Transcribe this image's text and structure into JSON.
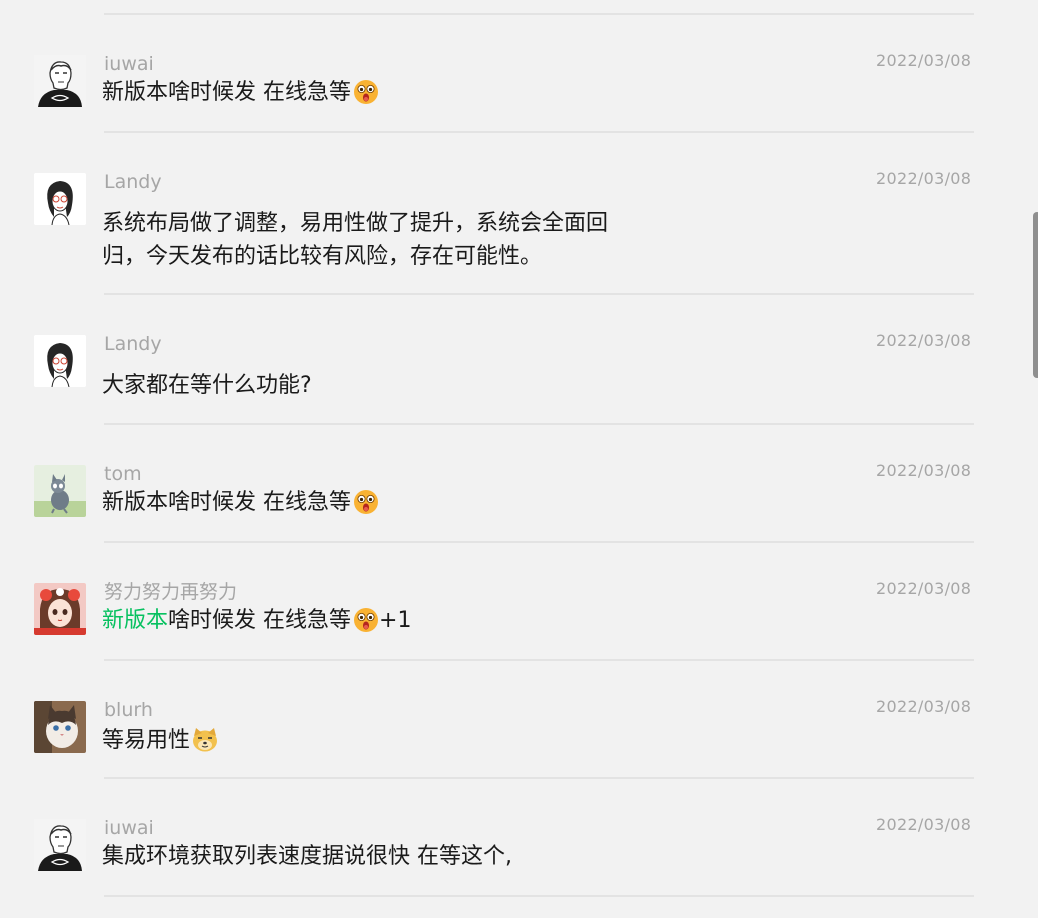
{
  "messages": [
    {
      "author": "iuwai",
      "date": "2022/03/08",
      "text": "新版本啥时候发  在线急等",
      "emoji": "surprised-face-emoji"
    },
    {
      "author": "Landy",
      "date": "2022/03/08",
      "line1": "系统布局做了调整，易用性做了提升，系统会全面回",
      "line2": "归，今天发布的话比较有风险，存在可能性。"
    },
    {
      "author": "Landy",
      "date": "2022/03/08",
      "text": "大家都在等什么功能?"
    },
    {
      "author": "tom",
      "date": "2022/03/08",
      "text": "新版本啥时候发  在线急等",
      "emoji": "surprised-face-emoji"
    },
    {
      "author": "努力努力再努力",
      "date": "2022/03/08",
      "highlight": "新版本",
      "text_rest": "啥时候发  在线急等",
      "suffix": "+1",
      "emoji": "surprised-face-emoji",
      "highlight_color": "#07c160"
    },
    {
      "author": "blurh",
      "date": "2022/03/08",
      "text": "等易用性",
      "emoji": "doge-emoji"
    },
    {
      "author": "iuwai",
      "date": "2022/03/08",
      "text": "集成环境获取列表速度据说很快  在等这个,"
    }
  ]
}
